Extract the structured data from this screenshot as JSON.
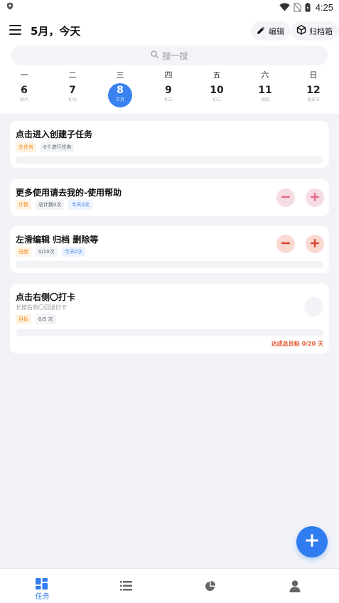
{
  "status_bar": {
    "time": "4:25"
  },
  "header": {
    "title": "5月，今天",
    "edit_label": "编辑",
    "archive_label": "归档箱",
    "search_placeholder": "搜一搜"
  },
  "week": [
    {
      "weekday": "一",
      "date": "6",
      "lunar": "初六"
    },
    {
      "weekday": "二",
      "date": "7",
      "lunar": "初七"
    },
    {
      "weekday": "三",
      "date": "8",
      "lunar": "芒月",
      "selected": true
    },
    {
      "weekday": "四",
      "date": "9",
      "lunar": "初三"
    },
    {
      "weekday": "五",
      "date": "10",
      "lunar": "初三"
    },
    {
      "weekday": "六",
      "date": "11",
      "lunar": "初四"
    },
    {
      "weekday": "日",
      "date": "12",
      "lunar": "母亲节"
    }
  ],
  "cards": [
    {
      "title": "点击进入创建子任务",
      "tags": [
        "去任务",
        "0个进行任务"
      ]
    },
    {
      "title": "更多使用请去我的-使用帮助",
      "tags": [
        "计数",
        "总计数0次",
        "今天0次"
      ]
    },
    {
      "title": "左滑编辑 归档 删除等",
      "tags": [
        "进度",
        "0/10次",
        "今天0次"
      ]
    },
    {
      "title": "点击右侧〇打卡",
      "subtitle": "长按右侧〇回退打卡",
      "tags": [
        "目标",
        "0/5 次"
      ],
      "goal": "达成总目标 0/20 天"
    }
  ],
  "bottom_nav": {
    "tasks_label": "任务"
  },
  "colors": {
    "accent": "#2f7df0",
    "minus_pink": "#f6dde3",
    "minus_red": "#f9d9d2"
  }
}
